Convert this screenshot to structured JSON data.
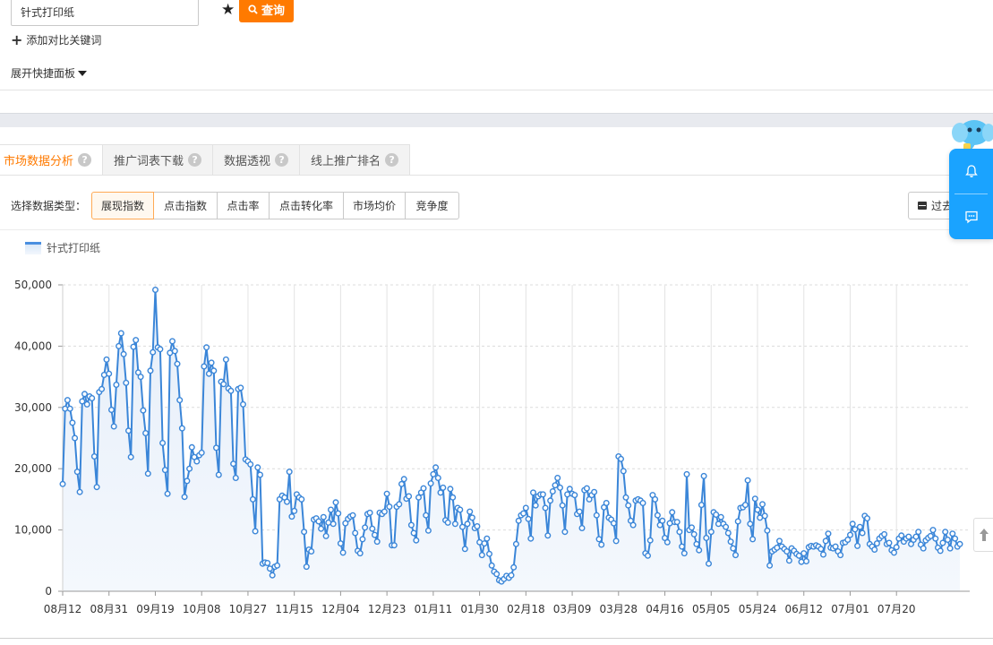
{
  "search": {
    "keyword": "针式打印纸",
    "button_label": "查询",
    "add_compare_label": "添加对比关键词",
    "expand_panel_label": "展开快捷面板"
  },
  "tabs": [
    {
      "label": "市场数据分析",
      "active": true
    },
    {
      "label": "推广词表下载",
      "active": false
    },
    {
      "label": "数据透视",
      "active": false
    },
    {
      "label": "线上推广排名",
      "active": false
    }
  ],
  "data_type": {
    "label": "选择数据类型：",
    "options": [
      "展现指数",
      "点击指数",
      "点击率",
      "点击转化率",
      "市场均价",
      "竞争度"
    ],
    "selected": "展现指数"
  },
  "date_range": {
    "label": "过去"
  },
  "colors": {
    "accent": "#ff7a00",
    "line": "#3b86d8",
    "float_panel": "#1aa3ff"
  },
  "chart_data": {
    "type": "area",
    "series": [
      {
        "name": "针式打印纸",
        "values": [
          17500,
          29800,
          31200,
          29800,
          27500,
          25000,
          19500,
          16200,
          31000,
          32200,
          30500,
          31800,
          31500,
          22000,
          17000,
          32500,
          33000,
          35300,
          37800,
          35500,
          29600,
          26900,
          33700,
          40000,
          42100,
          38700,
          34000,
          26200,
          21900,
          39900,
          41000,
          35700,
          35000,
          29500,
          25800,
          19200,
          36000,
          39000,
          49200,
          39800,
          39500,
          24200,
          19800,
          15900,
          38900,
          40800,
          39200,
          37100,
          31200,
          26600,
          15400,
          18000,
          20000,
          23500,
          21900,
          21200,
          22200,
          22600,
          36700,
          39800,
          35500,
          37300,
          36000,
          23400,
          19000,
          34200,
          33800,
          37800,
          33100,
          32700,
          20800,
          18500,
          33000,
          33200,
          30500,
          21500,
          21200,
          20700,
          15000,
          9800,
          20200,
          19000,
          4500,
          4700,
          4600,
          3700,
          2600,
          4000,
          4200,
          15000,
          15600,
          15300,
          14600,
          19500,
          12200,
          13100,
          15800,
          15300,
          15000,
          9700,
          4000,
          6800,
          6500,
          11700,
          11900,
          11400,
          10200,
          12100,
          9000,
          11200,
          13300,
          11000,
          14500,
          12700,
          7800,
          6300,
          11100,
          11800,
          12200,
          12400,
          9500,
          6600,
          6200,
          8500,
          10400,
          12600,
          12800,
          10200,
          9200,
          8100,
          12800,
          12600,
          13000,
          15900,
          13800,
          7500,
          7500,
          13800,
          14200,
          17500,
          18300,
          15100,
          15500,
          10800,
          9500,
          8300,
          15300,
          16100,
          16800,
          12400,
          9900,
          17600,
          19100,
          20200,
          18500,
          16100,
          16900,
          11600,
          11200,
          16700,
          15300,
          11000,
          13600,
          13300,
          10500,
          6900,
          11000,
          13000,
          12000,
          10300,
          10600,
          8000,
          5900,
          7800,
          8600,
          6100,
          4200,
          3200,
          2800,
          1800,
          1600,
          2000,
          2500,
          2200,
          2600,
          3900,
          7700,
          11500,
          12400,
          12700,
          13600,
          11800,
          8600,
          16100,
          14000,
          15500,
          15800,
          15800,
          13600,
          9100,
          14800,
          16300,
          17300,
          18500,
          16900,
          14000,
          9700,
          15800,
          16700,
          15900,
          15700,
          12600,
          13000,
          10300,
          16500,
          16800,
          15000,
          15700,
          16200,
          12400,
          8500,
          7600,
          13700,
          14400,
          12000,
          11700,
          11100,
          8200,
          22000,
          21600,
          19600,
          15300,
          14000,
          11500,
          10800,
          14800,
          15000,
          14800,
          14400,
          6200,
          5800,
          8300,
          15700,
          15000,
          12400,
          10800,
          11500,
          8700,
          8000,
          11100,
          12900,
          11300,
          11300,
          9700,
          7300,
          6200,
          19100,
          10000,
          10400,
          9300,
          7700,
          6700,
          14100,
          18800,
          8700,
          4500,
          9700,
          12900,
          12500,
          11000,
          12100,
          11000,
          10500,
          9500,
          8100,
          7000,
          5900,
          11400,
          13600,
          13700,
          14100,
          18100,
          11000,
          8500,
          15100,
          13300,
          12000,
          14200,
          12300,
          9900,
          4200,
          6500,
          6800,
          7100,
          8200,
          7300,
          6900,
          6500,
          5000,
          7000,
          6600,
          6100,
          5800,
          4800,
          6200,
          4900,
          7200,
          7400,
          7300,
          7500,
          7300,
          6900,
          6000,
          8200,
          9400,
          7100,
          7000,
          7300,
          6500,
          5900,
          7900,
          8000,
          8400,
          9200,
          11000,
          10100,
          7400,
          10500,
          9500,
          12300,
          11900,
          7700,
          7300,
          6800,
          7800,
          8600,
          9000,
          9300,
          7700,
          7900,
          6700,
          6300,
          7200,
          8600,
          9100,
          8100,
          8600,
          8900,
          7700,
          8400,
          8900,
          9700,
          7600,
          7000,
          8300,
          8700,
          9000,
          10000,
          8600,
          7100,
          6600,
          7900,
          9700,
          8400,
          7000,
          9400,
          8600,
          7300,
          7700
        ]
      }
    ],
    "x_tick_labels": [
      "08月12",
      "08月31",
      "09月19",
      "10月08",
      "10月27",
      "11月15",
      "12月04",
      "12月23",
      "01月11",
      "01月30",
      "02月18",
      "03月09",
      "03月28",
      "04月16",
      "05月05",
      "05月24",
      "06月12",
      "07月01",
      "07月20"
    ],
    "y_tick_labels": [
      "0",
      "10,000",
      "20,000",
      "30,000",
      "40,000",
      "50,000"
    ],
    "ylim": [
      0,
      50000
    ],
    "grid": true,
    "legend_position": "top-left"
  }
}
